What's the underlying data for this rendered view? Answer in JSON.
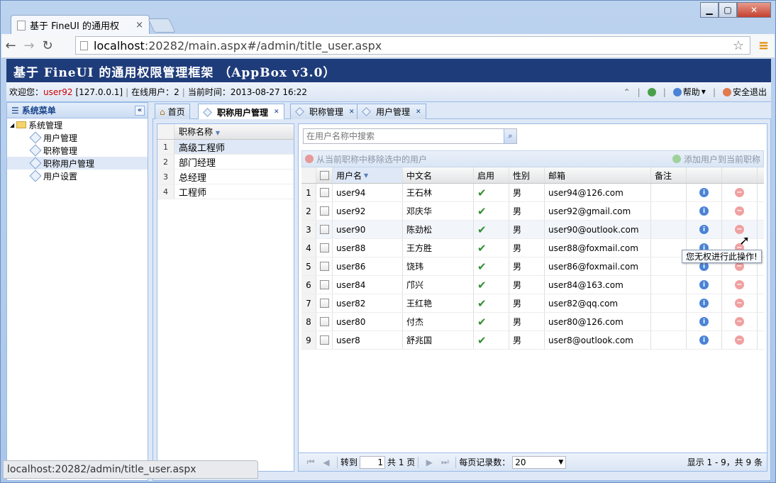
{
  "browser": {
    "tab_title": "基于 FineUI 的通用权",
    "tab_close": "×",
    "url_host": "localhost",
    "url_rest": ":20282/main.aspx#/admin/title_user.aspx",
    "status_url": "localhost:20282/admin/title_user.aspx"
  },
  "app": {
    "title": "基于 FineUI 的通用权限管理框架 （AppBox v3.0）",
    "welcome_label": "欢迎您：",
    "username": "user92",
    "ip": "[127.0.0.1]",
    "online_label": "在线用户：",
    "online_count": "2",
    "time_label": "当前时间：",
    "time": "2013-08-27 16:22",
    "help_label": "帮助",
    "logout_label": "安全退出"
  },
  "sidebar": {
    "title": "系统菜单",
    "root": "系统管理",
    "items": [
      {
        "label": "用户管理"
      },
      {
        "label": "职称管理"
      },
      {
        "label": "职称用户管理"
      },
      {
        "label": "用户设置"
      }
    ]
  },
  "tabs": [
    {
      "label": "首页"
    },
    {
      "label": "职称用户管理"
    },
    {
      "label": "职称管理"
    },
    {
      "label": "用户管理"
    }
  ],
  "title_grid": {
    "header": "职称名称",
    "rows": [
      {
        "n": "1",
        "name": "高级工程师"
      },
      {
        "n": "2",
        "name": "部门经理"
      },
      {
        "n": "3",
        "name": "总经理"
      },
      {
        "n": "4",
        "name": "工程师"
      }
    ]
  },
  "user_panel": {
    "search_placeholder": "在用户名称中搜索",
    "remove_label": "从当前职称中移除选中的用户",
    "add_label": "添加用户到当前职称",
    "columns": [
      "用户名",
      "中文名",
      "启用",
      "性别",
      "邮箱",
      "备注"
    ],
    "rows": [
      {
        "n": "1",
        "user": "user94",
        "cn": "王石林",
        "sex": "男",
        "email": "user94@126.com"
      },
      {
        "n": "2",
        "user": "user92",
        "cn": "邓庆华",
        "sex": "男",
        "email": "user92@gmail.com"
      },
      {
        "n": "3",
        "user": "user90",
        "cn": "陈劲松",
        "sex": "男",
        "email": "user90@outlook.com"
      },
      {
        "n": "4",
        "user": "user88",
        "cn": "王方胜",
        "sex": "男",
        "email": "user88@foxmail.com"
      },
      {
        "n": "5",
        "user": "user86",
        "cn": "饶玮",
        "sex": "男",
        "email": "user86@foxmail.com"
      },
      {
        "n": "6",
        "user": "user84",
        "cn": "邝兴",
        "sex": "男",
        "email": "user84@163.com"
      },
      {
        "n": "7",
        "user": "user82",
        "cn": "王红艳",
        "sex": "男",
        "email": "user82@qq.com"
      },
      {
        "n": "8",
        "user": "user80",
        "cn": "付杰",
        "sex": "男",
        "email": "user80@126.com"
      },
      {
        "n": "9",
        "user": "user8",
        "cn": "舒兆国",
        "sex": "男",
        "email": "user8@outlook.com"
      }
    ],
    "tooltip": "您无权进行此操作!"
  },
  "pager": {
    "goto_label": "转到",
    "page_value": "1",
    "total_pages": "共 1 页",
    "page_size_label": "每页记录数：",
    "page_size": "20",
    "display": "显示 1 - 9，共 9 条"
  }
}
